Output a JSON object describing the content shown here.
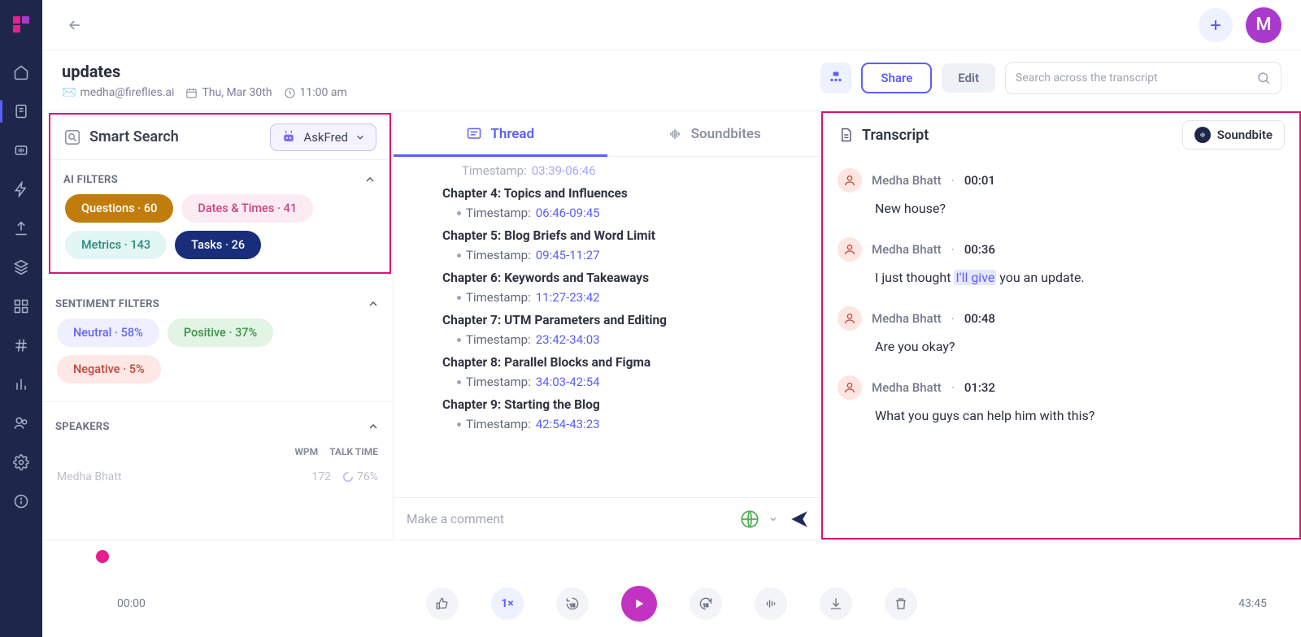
{
  "sidebar": {},
  "header": {
    "title": "updates",
    "email": "medha@fireflies.ai",
    "date": "Thu, Mar 30th",
    "time": "11:00 am",
    "share": "Share",
    "edit": "Edit",
    "search_placeholder": "Search across the transcript",
    "avatar_letter": "M"
  },
  "smart_search": {
    "title": "Smart Search",
    "askfred": "AskFred",
    "ai_filters_label": "AI FILTERS",
    "sentiment_label": "SENTIMENT FILTERS",
    "speakers_label": "SPEAKERS",
    "chips": {
      "questions": "Questions · 60",
      "dates": "Dates & Times · 41",
      "metrics": "Metrics · 143",
      "tasks": "Tasks · 26",
      "neutral": "Neutral · 58%",
      "positive": "Positive · 37%",
      "negative": "Negative · 5%"
    },
    "cols": {
      "wpm": "WPM",
      "talk": "TALK TIME"
    },
    "speaker_row": {
      "name": "Medha Bhatt",
      "wpm": "172",
      "talk": "76%"
    }
  },
  "tabs": {
    "thread": "Thread",
    "soundbites": "Soundbites"
  },
  "thread": {
    "top_ts_label": "Timestamp:",
    "top_ts_value": "03:39-06:46",
    "chapters": [
      {
        "title": "Chapter 4: Topics and Influences",
        "ts_label": "Timestamp:",
        "ts": "06:46-09:45"
      },
      {
        "title": "Chapter 5: Blog Briefs and Word Limit",
        "ts_label": "Timestamp:",
        "ts": "09:45-11:27"
      },
      {
        "title": "Chapter 6: Keywords and Takeaways",
        "ts_label": "Timestamp:",
        "ts": "11:27-23:42"
      },
      {
        "title": "Chapter 7: UTM Parameters and Editing",
        "ts_label": "Timestamp:",
        "ts": "23:42-34:03"
      },
      {
        "title": "Chapter 8: Parallel Blocks and Figma",
        "ts_label": "Timestamp:",
        "ts": "34:03-42:54"
      },
      {
        "title": "Chapter 9: Starting the Blog",
        "ts_label": "Timestamp:",
        "ts": "42:54-43:23"
      }
    ],
    "comment_placeholder": "Make a comment"
  },
  "transcript": {
    "title": "Transcript",
    "soundbite_btn": "Soundbite",
    "entries": [
      {
        "speaker": "Medha Bhatt",
        "time": "00:01",
        "text": "New house?"
      },
      {
        "speaker": "Medha Bhatt",
        "time": "00:36",
        "text_pre": "I just thought ",
        "text_hl": "I'll give",
        "text_post": " you an update."
      },
      {
        "speaker": "Medha Bhatt",
        "time": "00:48",
        "text": "Are you okay?"
      },
      {
        "speaker": "Medha Bhatt",
        "time": "01:32",
        "text": "What you guys can help him with this?"
      }
    ]
  },
  "player": {
    "current": "00:00",
    "total": "43:45",
    "speed": "1×"
  }
}
